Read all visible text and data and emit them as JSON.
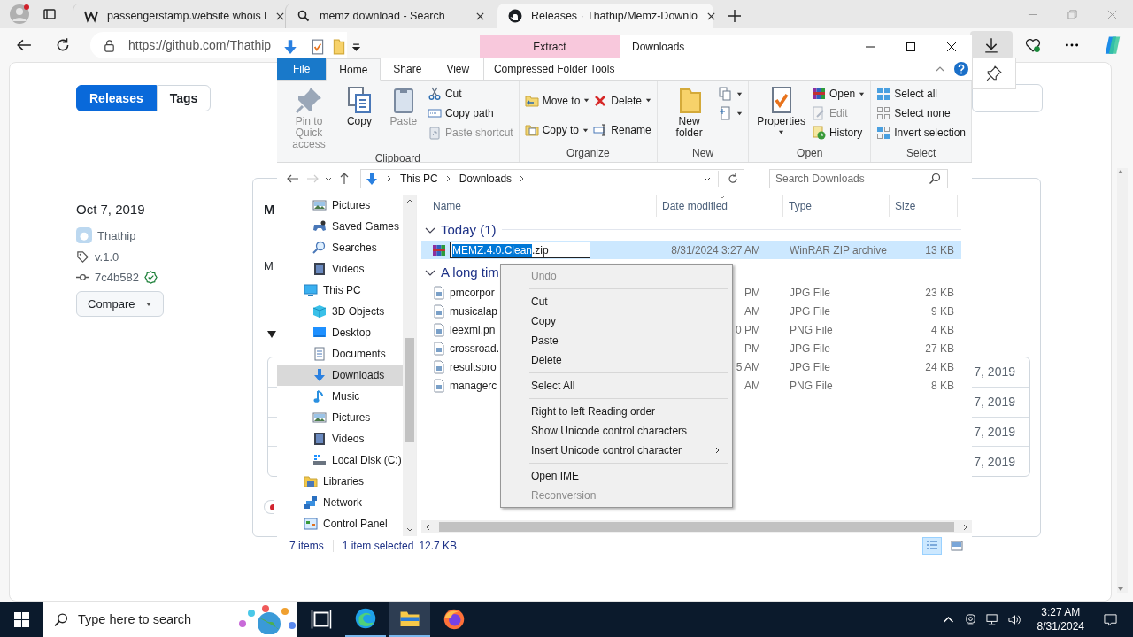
{
  "browser": {
    "tabs": [
      {
        "title": "passengerstamp.website whois l",
        "selected": false
      },
      {
        "title": "memz download - Search",
        "selected": false
      },
      {
        "title": "Releases · Thathip/Memz-Downlo",
        "selected": true
      }
    ],
    "address": "https://github.com/Thathip"
  },
  "release_page": {
    "nav_tabs": [
      {
        "label": "Releases",
        "selected": true
      },
      {
        "label": "Tags",
        "selected": false
      }
    ],
    "date": "Oct 7, 2019",
    "author": "Thathip",
    "tag": "v.1.0",
    "commit": "7c4b582",
    "verified": true,
    "compare": "Compare",
    "heading": "M",
    "subtitle": "M",
    "asset_dates": [
      "7, 2019",
      "7, 2019",
      "7, 2019",
      "7, 2019"
    ]
  },
  "explorer": {
    "title": "Downloads",
    "context_header": "Extract",
    "ribbon_tabs": [
      {
        "label": "File",
        "kind": "file",
        "selected": false
      },
      {
        "label": "Home",
        "kind": "tab",
        "selected": true
      },
      {
        "label": "Share",
        "kind": "tab",
        "selected": false
      },
      {
        "label": "View",
        "kind": "tab",
        "selected": false
      },
      {
        "label": "Compressed Folder Tools",
        "kind": "contextual",
        "selected": false
      }
    ],
    "ribbon_groups": [
      {
        "label": "Clipboard",
        "commands": [
          {
            "label": "Pin to Quick access",
            "kind": "large",
            "disabled": true
          },
          {
            "label": "Copy",
            "kind": "large",
            "disabled": false
          },
          {
            "label": "Paste",
            "kind": "large",
            "disabled": true
          },
          {
            "label": "Cut",
            "kind": "small",
            "disabled": false
          },
          {
            "label": "Copy path",
            "kind": "small",
            "disabled": false
          },
          {
            "label": "Paste shortcut",
            "kind": "small",
            "disabled": true
          }
        ]
      },
      {
        "label": "Organize",
        "commands": [
          {
            "label": "Move to",
            "kind": "medium",
            "dropdown": true,
            "disabled": false
          },
          {
            "label": "Copy to",
            "kind": "medium",
            "dropdown": true,
            "disabled": false
          },
          {
            "label": "Delete",
            "kind": "medium",
            "dropdown": true,
            "disabled": false
          },
          {
            "label": "Rename",
            "kind": "medium",
            "dropdown": false,
            "disabled": false
          }
        ]
      },
      {
        "label": "New",
        "commands": [
          {
            "label": "New folder",
            "kind": "large",
            "disabled": false
          },
          {
            "kind": "icon",
            "dropdown": true,
            "disabled": false
          },
          {
            "kind": "icon",
            "dropdown": true,
            "disabled": false
          }
        ]
      },
      {
        "label": "Open",
        "commands": [
          {
            "label": "Properties",
            "kind": "large",
            "dropdown": true,
            "disabled": false
          },
          {
            "label": "Open",
            "kind": "small",
            "dropdown": true,
            "disabled": false
          },
          {
            "label": "Edit",
            "kind": "small",
            "dropdown": false,
            "disabled": true
          },
          {
            "label": "History",
            "kind": "small",
            "dropdown": false,
            "disabled": false
          }
        ]
      },
      {
        "label": "Select",
        "commands": [
          {
            "label": "Select all",
            "kind": "small",
            "disabled": false
          },
          {
            "label": "Select none",
            "kind": "small",
            "disabled": false
          },
          {
            "label": "Invert selection",
            "kind": "small",
            "disabled": false
          }
        ]
      }
    ],
    "path": [
      "This PC",
      "Downloads"
    ],
    "search_placeholder": "Search Downloads",
    "nav_pane": {
      "scrolled_children": [
        {
          "label": "Pictures",
          "selected": false
        },
        {
          "label": "Saved Games",
          "selected": false
        },
        {
          "label": "Searches",
          "selected": false
        },
        {
          "label": "Videos",
          "selected": false
        }
      ],
      "items": [
        {
          "label": "This PC",
          "selected": false,
          "children": [
            {
              "label": "3D Objects",
              "selected": false
            },
            {
              "label": "Desktop",
              "selected": false
            },
            {
              "label": "Documents",
              "selected": false
            },
            {
              "label": "Downloads",
              "selected": true
            },
            {
              "label": "Music",
              "selected": false
            },
            {
              "label": "Pictures",
              "selected": false
            },
            {
              "label": "Videos",
              "selected": false
            },
            {
              "label": "Local Disk (C:)",
              "selected": false
            }
          ]
        },
        {
          "label": "Libraries",
          "selected": false
        },
        {
          "label": "Network",
          "selected": false
        },
        {
          "label": "Control Panel",
          "selected": false
        }
      ]
    },
    "columns": [
      "Name",
      "Date modified",
      "Type",
      "Size"
    ],
    "groups": [
      {
        "label": "Today (1)",
        "expanded": true,
        "files": [
          {
            "kind": "archive",
            "name_selected": "MEMZ.4.0.Clean",
            "name": ".zip",
            "date": "8/31/2024 3:27 AM",
            "type": "WinRAR ZIP archive",
            "size": "13 KB",
            "selected": true
          }
        ]
      },
      {
        "label": "A long tim",
        "expanded": true,
        "files": [
          {
            "kind": "image",
            "name": "pmcorpor",
            "date": "PM",
            "type": "JPG File",
            "size": "23 KB",
            "selected": false
          },
          {
            "kind": "image",
            "name": "musicalap",
            "date": "AM",
            "type": "JPG File",
            "size": "9 KB",
            "selected": false
          },
          {
            "kind": "image",
            "name": "leexml.pn",
            "date": "0 PM",
            "type": "PNG File",
            "size": "4 KB",
            "selected": false
          },
          {
            "kind": "image",
            "name": "crossroad.",
            "date": "PM",
            "type": "JPG File",
            "size": "27 KB",
            "selected": false
          },
          {
            "kind": "image",
            "name": "resultspro",
            "date": "5 AM",
            "type": "JPG File",
            "size": "24 KB",
            "selected": false
          },
          {
            "kind": "image",
            "name": "managerc",
            "date": "AM",
            "type": "PNG File",
            "size": "8 KB",
            "selected": false
          }
        ]
      }
    ],
    "status": {
      "count": "7 items",
      "selection": "1 item selected",
      "size": "12.7 KB"
    },
    "views": [
      {
        "kind": "details",
        "selected": true
      },
      {
        "kind": "large_icons",
        "selected": false
      }
    ]
  },
  "context_menu": {
    "sections": [
      {
        "items": [
          {
            "label": "Undo",
            "disabled": true,
            "submenu": false
          }
        ]
      },
      {
        "items": [
          {
            "label": "Cut",
            "disabled": false,
            "submenu": false
          },
          {
            "label": "Copy",
            "disabled": false,
            "submenu": false
          },
          {
            "label": "Paste",
            "disabled": false,
            "submenu": false
          },
          {
            "label": "Delete",
            "disabled": false,
            "submenu": false
          }
        ]
      },
      {
        "items": [
          {
            "label": "Select All",
            "disabled": false,
            "submenu": false
          }
        ]
      },
      {
        "items": [
          {
            "label": "Right to left Reading order",
            "disabled": false,
            "submenu": false
          },
          {
            "label": "Show Unicode control characters",
            "disabled": false,
            "submenu": false
          },
          {
            "label": "Insert Unicode control character",
            "disabled": false,
            "submenu": true
          }
        ]
      },
      {
        "items": [
          {
            "label": "Open IME",
            "disabled": false,
            "submenu": false
          },
          {
            "label": "Reconversion",
            "disabled": true,
            "submenu": false
          }
        ]
      }
    ]
  },
  "taskbar": {
    "search_placeholder": "Type here to search",
    "apps": [
      {
        "kind": "task_view",
        "running": false,
        "selected": false
      },
      {
        "kind": "edge",
        "running": true,
        "selected": false
      },
      {
        "kind": "explorer",
        "running": true,
        "selected": true
      },
      {
        "kind": "firefox",
        "running": false,
        "selected": false
      }
    ],
    "time": "3:27 AM",
    "date": "8/31/2024"
  }
}
